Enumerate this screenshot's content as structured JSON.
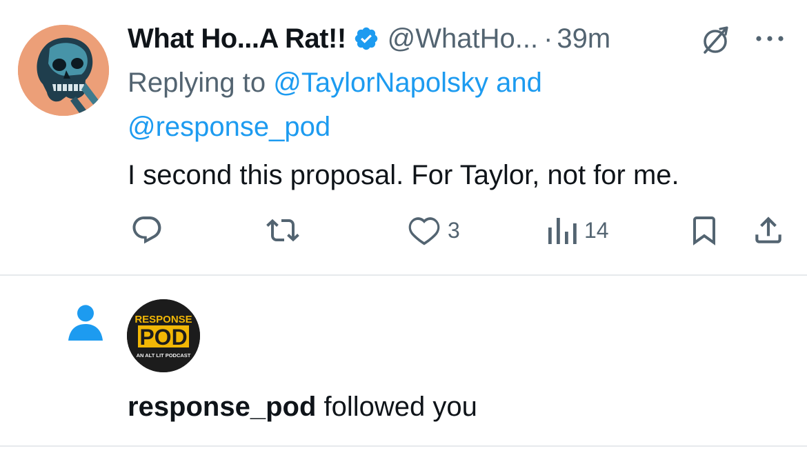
{
  "tweet": {
    "display_name": "What Ho...A Rat!!",
    "handle": "@WhatHo...",
    "separator": "·",
    "time": "39m",
    "replying_prefix": "Replying to ",
    "replying_mention_1": "@TaylorNapolsky",
    "replying_and": " and",
    "replying_mention_2": "@response_pod",
    "text": "I second this proposal. For Taylor, not for me.",
    "actions": {
      "reply_icon": "reply-icon",
      "retweet_icon": "retweet-icon",
      "like_icon": "heart-icon",
      "like_count": "3",
      "views_icon": "views-chart-icon",
      "views_count": "14",
      "bookmark_icon": "bookmark-icon",
      "share_icon": "share-icon"
    }
  },
  "notification": {
    "icon": "person-icon",
    "avatar_text_top": "RESPONSE",
    "avatar_text_mid": "POD",
    "avatar_text_bottom": "AN ALT LIT PODCAST",
    "username": "response_pod",
    "action_text": " followed you"
  },
  "colors": {
    "text_primary": "#0f1419",
    "text_secondary": "#536471",
    "link_blue": "#1d9bf0",
    "divider": "#e6e9ec",
    "pod_yellow": "#f2b705"
  }
}
